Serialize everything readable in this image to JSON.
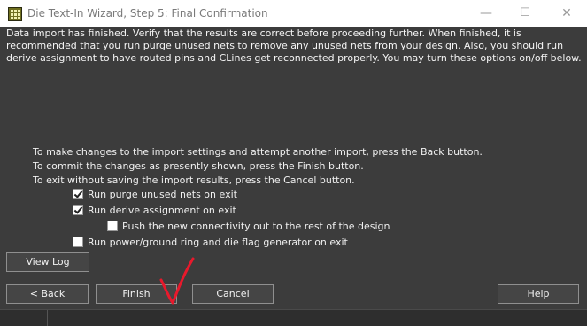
{
  "window": {
    "title": "Die Text-In Wizard, Step 5: Final Confirmation",
    "controls": {
      "minimize": "—",
      "maximize": "☐",
      "close": "✕"
    }
  },
  "intro_text": "Data import has finished. Verify that the results are correct before proceeding further. When finished, it is recommended that you run purge unused nets to remove any unused nets from your design. Also, you should run derive assignment to have routed pins and CLines get reconnected properly. You may turn these options on/off below.",
  "instructions": [
    "To make changes to the import settings and attempt another import, press the Back button.",
    "To commit the changes as presently shown, press the Finish button.",
    "To exit without saving the import results, press the Cancel button."
  ],
  "options": [
    {
      "label": "Run purge unused nets on exit",
      "checked": true
    },
    {
      "label": "Run derive assignment on exit",
      "checked": true
    },
    {
      "label": "Push the new connectivity out to the rest of the design",
      "checked": false
    },
    {
      "label": "Run power/ground ring and die flag generator on exit",
      "checked": false
    }
  ],
  "buttons": {
    "view_log": "View Log",
    "back": "< Back",
    "finish": "Finish",
    "cancel": "Cancel",
    "help": "Help"
  },
  "colors": {
    "background": "#3c3c3c",
    "button": "#454545",
    "annotation": "#e8192c"
  }
}
